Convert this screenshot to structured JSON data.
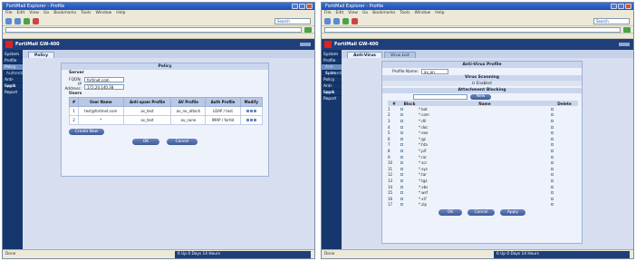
{
  "left_window": {
    "title": "FortiMail Explorer - Profile",
    "menu": [
      "File",
      "Edit",
      "View",
      "Go",
      "Bookmarks",
      "Tools",
      "Window",
      "Help"
    ],
    "search_label": "Search",
    "product_title": "FortiMail GW-400",
    "sidebar": [
      {
        "label": "System",
        "active": false,
        "sub": false
      },
      {
        "label": "Profile",
        "active": false,
        "sub": false
      },
      {
        "label": "Policy",
        "active": true,
        "sub": false
      },
      {
        "label": "Authentication",
        "active": false,
        "sub": true
      },
      {
        "label": "Anti-Spam",
        "active": false,
        "sub": false
      },
      {
        "label": "Log & Report",
        "active": false,
        "sub": false
      }
    ],
    "tab": "Policy",
    "panel_title": "Policy",
    "server_label": "Server",
    "fqdn_label": "FQDN:",
    "fqdn_value": "fortinet.com",
    "ip_label": "IP Address:",
    "ip_value": "172.20.140.38",
    "users_label": "Users",
    "table": {
      "headers": [
        "#",
        "User Name",
        "Anti-spam Profile",
        "AV Profile",
        "Auth Profile",
        "Modify"
      ],
      "rows": [
        [
          "1",
          "test@fortinet.com",
          "as_test",
          "av_no_attach",
          "LDAP / test",
          ""
        ],
        [
          "2",
          "*",
          "as_test",
          "av_none",
          "IMAP / fortld",
          ""
        ]
      ]
    },
    "create_new": "Create New",
    "ok": "OK",
    "cancel": "Cancel",
    "status_left": "Done",
    "status_mid": "6 Up 0 Days 14 Hours"
  },
  "right_window": {
    "title": "FortiMail Explorer - Profile",
    "menu": [
      "File",
      "Edit",
      "View",
      "Go",
      "Bookmarks",
      "Tools",
      "Window",
      "Help"
    ],
    "search_label": "Search",
    "product_title": "FortiMail GW-400",
    "sidebar": [
      {
        "label": "System",
        "active": false,
        "sub": false
      },
      {
        "label": "Profile",
        "active": false,
        "sub": false
      },
      {
        "label": "Anti-Spam",
        "active": true,
        "sub": true
      },
      {
        "label": "Authentication",
        "active": false,
        "sub": true
      },
      {
        "label": "Policy",
        "active": false,
        "sub": false
      },
      {
        "label": "Anti-Spam",
        "active": false,
        "sub": false
      },
      {
        "label": "Log & Report",
        "active": false,
        "sub": false
      }
    ],
    "tabs": [
      "Anti-Virus",
      "Virus List"
    ],
    "panel_title": "Anti-Virus Profile",
    "profile_name_label": "Profile Name:",
    "profile_name_value": "av_on",
    "virus_scanning_label": "Virus Scanning",
    "virus_enabled": "Enabled",
    "attachment_blocking_label": "Attachment Blocking",
    "new_button": "New",
    "table_headers": [
      "#",
      "Block",
      "Name",
      "Delete"
    ],
    "attachments": [
      "*.bat",
      "*.com",
      "*.dll",
      "*.doc",
      "*.exe",
      "*.gz",
      "*.hta",
      "*.pif",
      "*.rar",
      "*.scr",
      "*.sys",
      "*.tar",
      "*.tgz",
      "*.vbs",
      "*.wsf",
      "*.xl?",
      "*.zip"
    ],
    "ok": "OK",
    "cancel": "Cancel",
    "apply": "Apply",
    "status_left": "Done",
    "status_mid": "6 Up 0 Days 14 Hours"
  }
}
